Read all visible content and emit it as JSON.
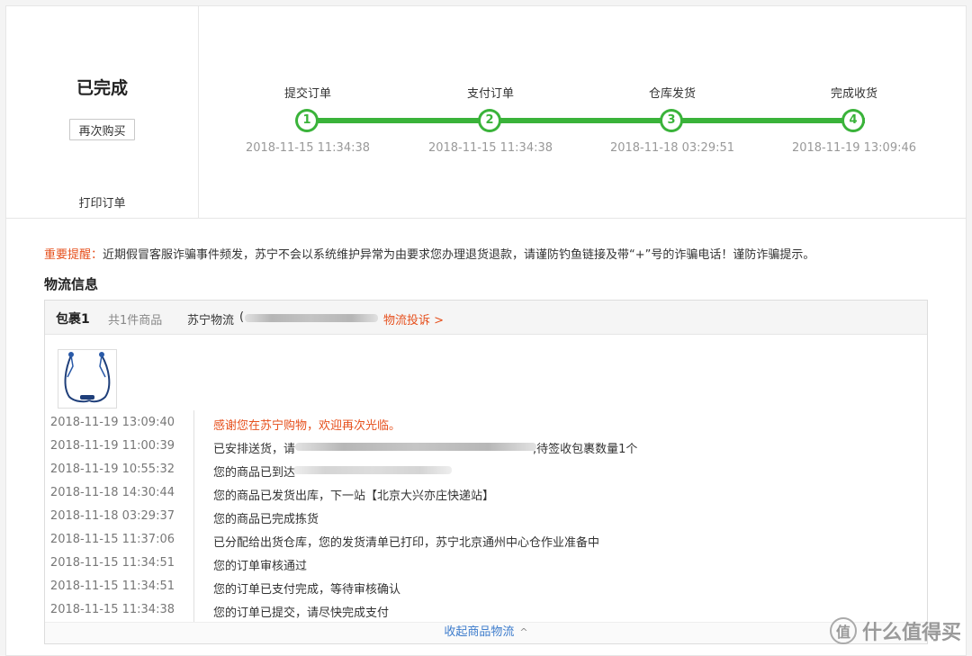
{
  "order_status": {
    "title": "已完成",
    "rebuy_label": "再次购买",
    "print_label": "打印订单"
  },
  "progress": {
    "steps": [
      {
        "label": "提交订单",
        "num": "1",
        "time": "2018-11-15 11:34:38"
      },
      {
        "label": "支付订单",
        "num": "2",
        "time": "2018-11-15 11:34:38"
      },
      {
        "label": "仓库发货",
        "num": "3",
        "time": "2018-11-18 03:29:51"
      },
      {
        "label": "完成收货",
        "num": "4",
        "time": "2018-11-19 13:09:46"
      }
    ],
    "color": "#3ab33a"
  },
  "notice": {
    "label": "重要提醒：",
    "text": "近期假冒客服诈骗事件频发，苏宁不会以系统维护异常为由要求您办理退货退款，请谨防钓鱼链接及带“+”号的诈骗电话！谨防诈骗提示。"
  },
  "logistics": {
    "section_title": "物流信息",
    "package_name": "包裹1",
    "item_count": "共1件商品",
    "carrier": "苏宁物流",
    "paren_open": "(",
    "complaint_label": "物流投诉",
    "complaint_chevron": ">",
    "collapse_label": "收起商品物流",
    "collapse_chevron": "^",
    "events": [
      {
        "time": "2018-11-19 13:09:40",
        "text": "感谢您在苏宁购物，欢迎再次光临。"
      },
      {
        "time": "2018-11-19 11:00:39",
        "text": "已安排送货，请",
        "suffix": ",待签收包裹数量1个"
      },
      {
        "time": "2018-11-19 10:55:32",
        "text": "您的商品已到达"
      },
      {
        "time": "2018-11-18 14:30:44",
        "text": "您的商品已发货出库，下一站【北京大兴亦庄快递站】"
      },
      {
        "time": "2018-11-18 03:29:37",
        "text": "您的商品已完成拣货"
      },
      {
        "time": "2018-11-15 11:37:06",
        "text": "已分配给出货仓库，您的发货清单已打印，苏宁北京通州中心仓作业准备中"
      },
      {
        "time": "2018-11-15 11:34:51",
        "text": "您的订单审核通过"
      },
      {
        "time": "2018-11-15 11:34:51",
        "text": "您的订单已支付完成，等待审核确认"
      },
      {
        "time": "2018-11-15 11:34:38",
        "text": "您的订单已提交，请尽快完成支付"
      }
    ]
  },
  "watermark": {
    "logo_char": "值",
    "text": "什么值得买"
  },
  "colors": {
    "accent_orange": "#e6501d",
    "link_blue": "#3d7ccc",
    "success_green": "#3ab33a"
  }
}
